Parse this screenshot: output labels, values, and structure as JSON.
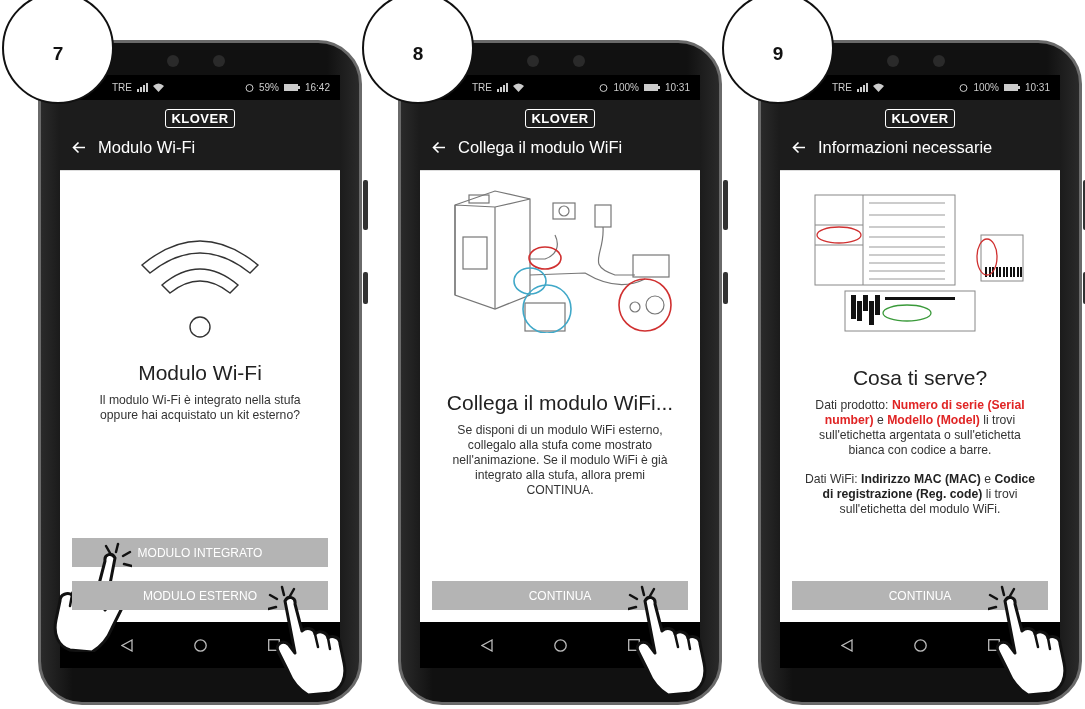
{
  "phones": [
    {
      "step": "7",
      "status": {
        "carrier": "TRE",
        "battery": "59%",
        "time": "16:42"
      },
      "logo": "KLOVER",
      "title": "Modulo Wi-Fi",
      "illustration": {
        "kind": "wifi"
      },
      "heading": "Modulo Wi-Fi",
      "paragraphs": [
        {
          "text": "Il modulo Wi-Fi è integrato nella stufa oppure hai acquistato un kit esterno?"
        }
      ],
      "buttons": [
        {
          "label": "MODULO INTEGRATO",
          "tapped": true,
          "tap_from_left": true
        },
        {
          "label": "MODULO ESTERNO",
          "tapped": true,
          "tap_from_left": false
        }
      ]
    },
    {
      "step": "8",
      "status": {
        "carrier": "TRE",
        "battery": "100%",
        "time": "10:31"
      },
      "logo": "KLOVER",
      "title": "Collega il modulo WiFi",
      "illustration": {
        "kind": "stove"
      },
      "heading": "Collega il modulo WiFi...",
      "paragraphs": [
        {
          "text": "Se disponi di un modulo WiFi esterno, collegalo alla stufa come mostrato nell'animazione. Se il modulo WiFi è già integrato alla stufa, allora premi CONTINUA."
        }
      ],
      "buttons": [
        {
          "label": "CONTINUA",
          "tapped": true,
          "tap_from_left": false
        }
      ]
    },
    {
      "step": "9",
      "status": {
        "carrier": "TRE",
        "battery": "100%",
        "time": "10:31"
      },
      "logo": "KLOVER",
      "title": "Informazioni necessarie",
      "illustration": {
        "kind": "labels"
      },
      "heading": "Cosa ti serve?",
      "paragraphs": [
        {
          "text": "Dati prodotto: **Numero di serie (Serial number)** e **Modello (Model)** li trovi sull'etichetta argentata o sull'etichetta bianca con codice a barre.",
          "color": "#e02424"
        },
        {
          "text": "Dati WiFi: **Indirizzo MAC (MAC)** e **Codice di registrazione (Reg. code)** li trovi sull'etichetta del modulo WiFi.",
          "color": "#222222"
        }
      ],
      "buttons": [
        {
          "label": "CONTINUA",
          "tapped": true,
          "tap_from_left": false
        }
      ]
    }
  ]
}
